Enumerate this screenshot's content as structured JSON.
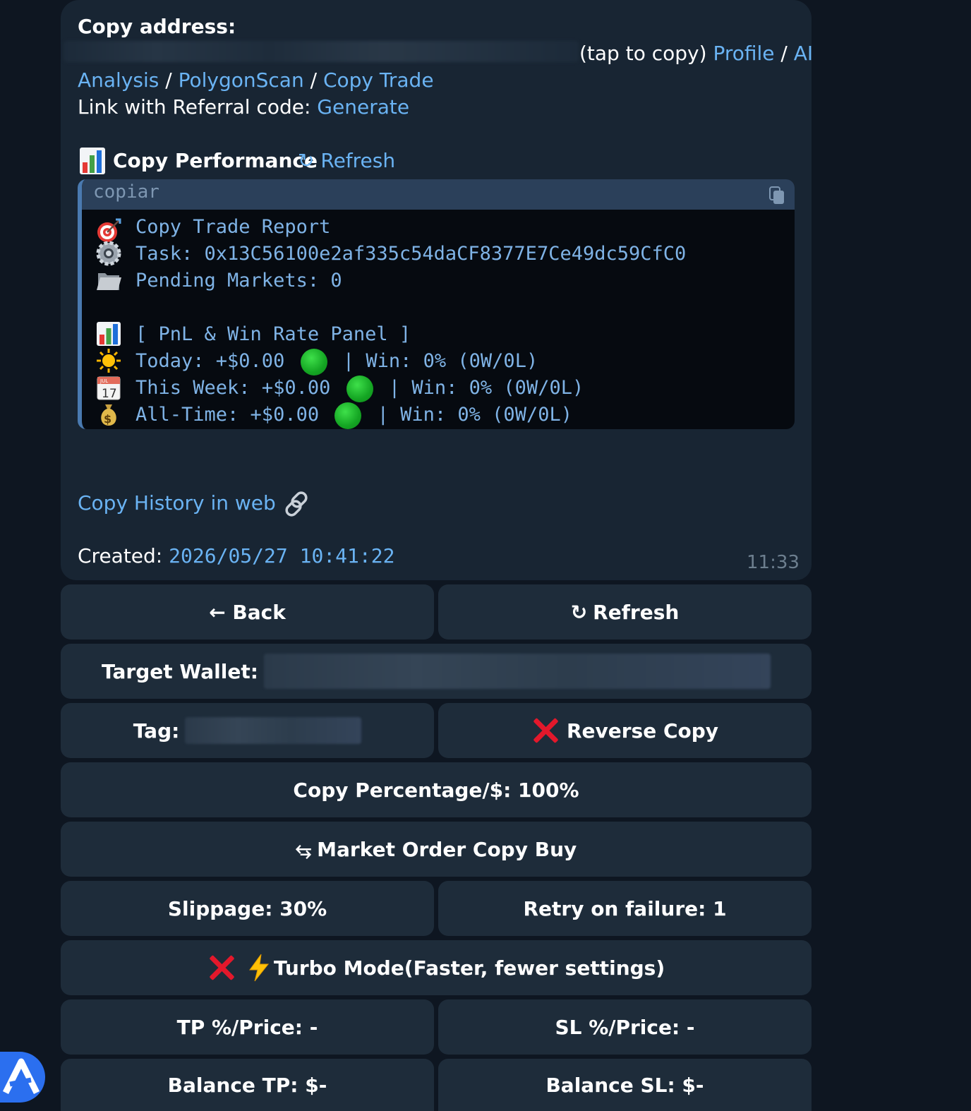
{
  "header": {
    "copy_address_label": "Copy address:",
    "tap_to_copy": "(tap to copy)",
    "profile_link": "Profile",
    "slash": "/",
    "ai_link": "AI"
  },
  "links": {
    "analysis": "Analysis",
    "polygonscan": "PolygonScan",
    "copy_trade": "Copy Trade",
    "referral_label": "Link with Referral code:",
    "generate": "Generate"
  },
  "performance": {
    "title": "Copy Performance",
    "refresh": "Refresh"
  },
  "code_block": {
    "language": "copiar",
    "lines": [
      "Copy Trade Report",
      "Task: 0x13C56100e2af335c54daCF8377E7Ce49dc59CfC0",
      "Pending Markets: 0",
      "[ PnL & Win Rate Panel ]"
    ],
    "today_label": "Today: +$0.00",
    "today_win": "| Win: 0% (0W/0L)",
    "week_label": "This Week: +$0.00",
    "week_win": "| Win: 0% (0W/0L)",
    "alltime_label": "All-Time: +$0.00",
    "alltime_win": "| Win: 0% (0W/0L)",
    "calendar_month": "JUL",
    "calendar_day": "17"
  },
  "history_link": "Copy History in web",
  "created": {
    "label": "Created:",
    "value": "2026/05/27 10:41:22"
  },
  "message_time": "11:33",
  "buttons": {
    "back": "← Back",
    "refresh": "Refresh",
    "target_wallet": "Target Wallet:",
    "tag": "Tag:",
    "reverse_copy": "Reverse Copy",
    "copy_percentage": "Copy Percentage/$: 100%",
    "market_order": "Market Order Copy Buy",
    "slippage": "Slippage: 30%",
    "retry": "Retry on failure: 1",
    "turbo": "Turbo Mode(Faster, fewer settings)",
    "tp": "TP %/Price: -",
    "sl": "SL %/Price: -",
    "balance_tp": "Balance TP: $-",
    "balance_sl": "Balance SL: $-"
  },
  "colors": {
    "background": "#0e1621",
    "bubble": "#182533",
    "link": "#6ab3f3",
    "button": "#1e2c3a",
    "code_text": "#7fb3e6"
  },
  "icons": [
    "bar-chart-icon",
    "refresh-icon",
    "copy-icon",
    "target-icon",
    "gear-icon",
    "folder-icon",
    "sun-icon",
    "calendar-icon",
    "money-bag-icon",
    "green-circle-icon",
    "link-icon",
    "cross-mark-icon",
    "lightning-icon",
    "swap-arrows-icon",
    "app-logo-icon"
  ]
}
